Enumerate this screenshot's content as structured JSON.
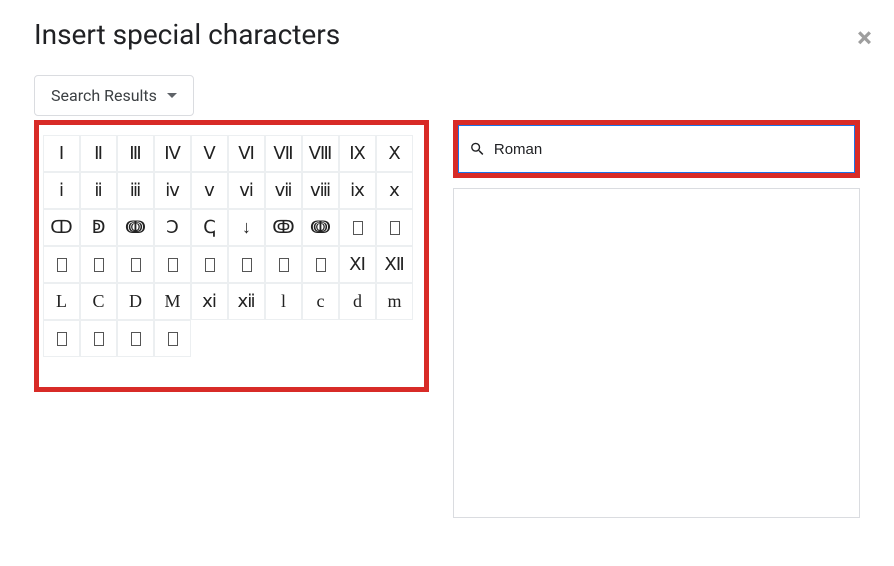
{
  "header": {
    "title": "Insert special characters"
  },
  "dropdown": {
    "label": "Search Results"
  },
  "search": {
    "value": "Roman",
    "placeholder": ""
  },
  "grid": {
    "rows": [
      [
        "Ⅰ",
        "Ⅱ",
        "Ⅲ",
        "Ⅳ",
        "Ⅴ",
        "Ⅵ",
        "Ⅶ",
        "Ⅷ",
        "Ⅸ",
        "Ⅹ"
      ],
      [
        "ⅰ",
        "ⅱ",
        "ⅲ",
        "ⅳ",
        "ⅴ",
        "ⅵ",
        "ⅶ",
        "ⅷ",
        "ⅸ",
        "ⅹ"
      ],
      [
        "ↀ",
        "ↁ",
        "ↈ",
        "Ↄ",
        "ↅ",
        "↓",
        "ↂ",
        "ↈ",
        "□",
        "□"
      ],
      [
        "□",
        "□",
        "□",
        "□",
        "□",
        "□",
        "□",
        "□",
        "Ⅺ",
        "Ⅻ"
      ],
      [
        "L",
        "C",
        "D",
        "M",
        "ⅺ",
        "ⅻ",
        "l",
        "c",
        "d",
        "m"
      ],
      [
        "□",
        "□",
        "□",
        "□"
      ]
    ]
  }
}
